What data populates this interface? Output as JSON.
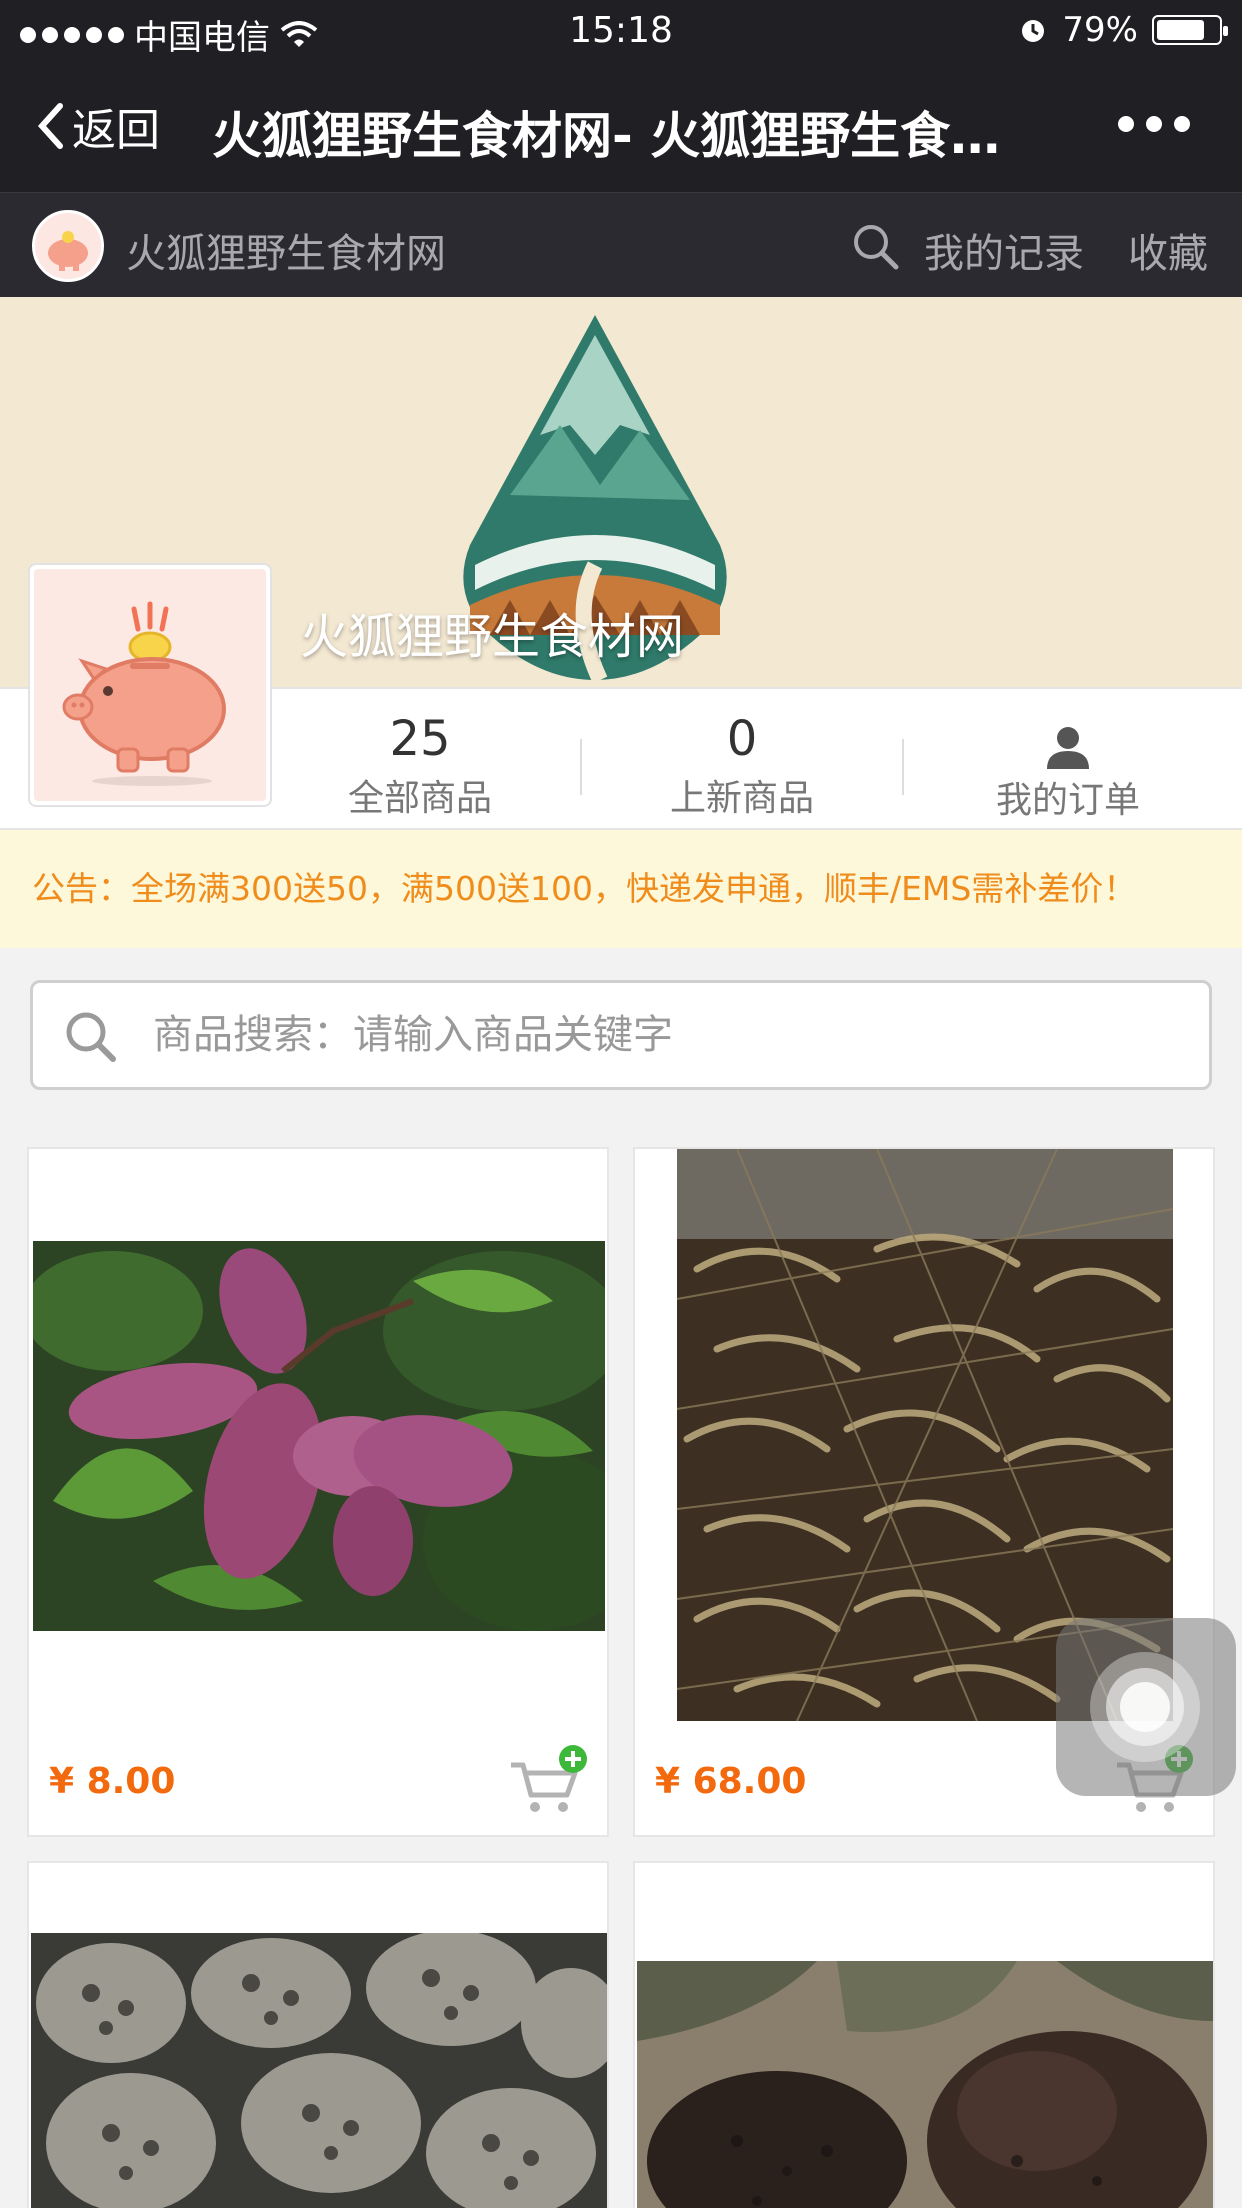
{
  "status_bar": {
    "carrier": "中国电信",
    "time": "15:18",
    "battery": "79%",
    "battery_level": 0.79
  },
  "nav": {
    "back_label": "返回",
    "title": "火狐狸野生食材网- 火狐狸野生食…",
    "more_icon": "more-dots-icon"
  },
  "shop_bar": {
    "name": "火狐狸野生食材网",
    "records": "我的记录",
    "favorites": "收藏"
  },
  "banner": {
    "title": "火狐狸野生食材网"
  },
  "stats": {
    "all_products_count": "25",
    "all_products_label": "全部商品",
    "new_products_count": "0",
    "new_products_label": "上新商品",
    "orders_label": "我的订单"
  },
  "notice": {
    "text": "公告：全场满300送50，满500送100，快递发申通，顺丰/EMS需补差价！"
  },
  "search": {
    "placeholder": "商品搜索：请输入商品关键字",
    "value": ""
  },
  "products": [
    {
      "price": "¥ 8.00",
      "image": "purple-wild-fruit"
    },
    {
      "price": "¥ 68.00",
      "image": "dried-river-shrimp"
    },
    {
      "price": "",
      "image": "morel-mushrooms"
    },
    {
      "price": "",
      "image": "black-truffles"
    }
  ],
  "colors": {
    "nav_bg": "#1f1f24",
    "price": "#f26a0d",
    "notice_text": "#f08c1c",
    "notice_bg": "#fdf8da",
    "banner_bg": "#f3e8d2",
    "cart_plus": "#3db83a"
  }
}
